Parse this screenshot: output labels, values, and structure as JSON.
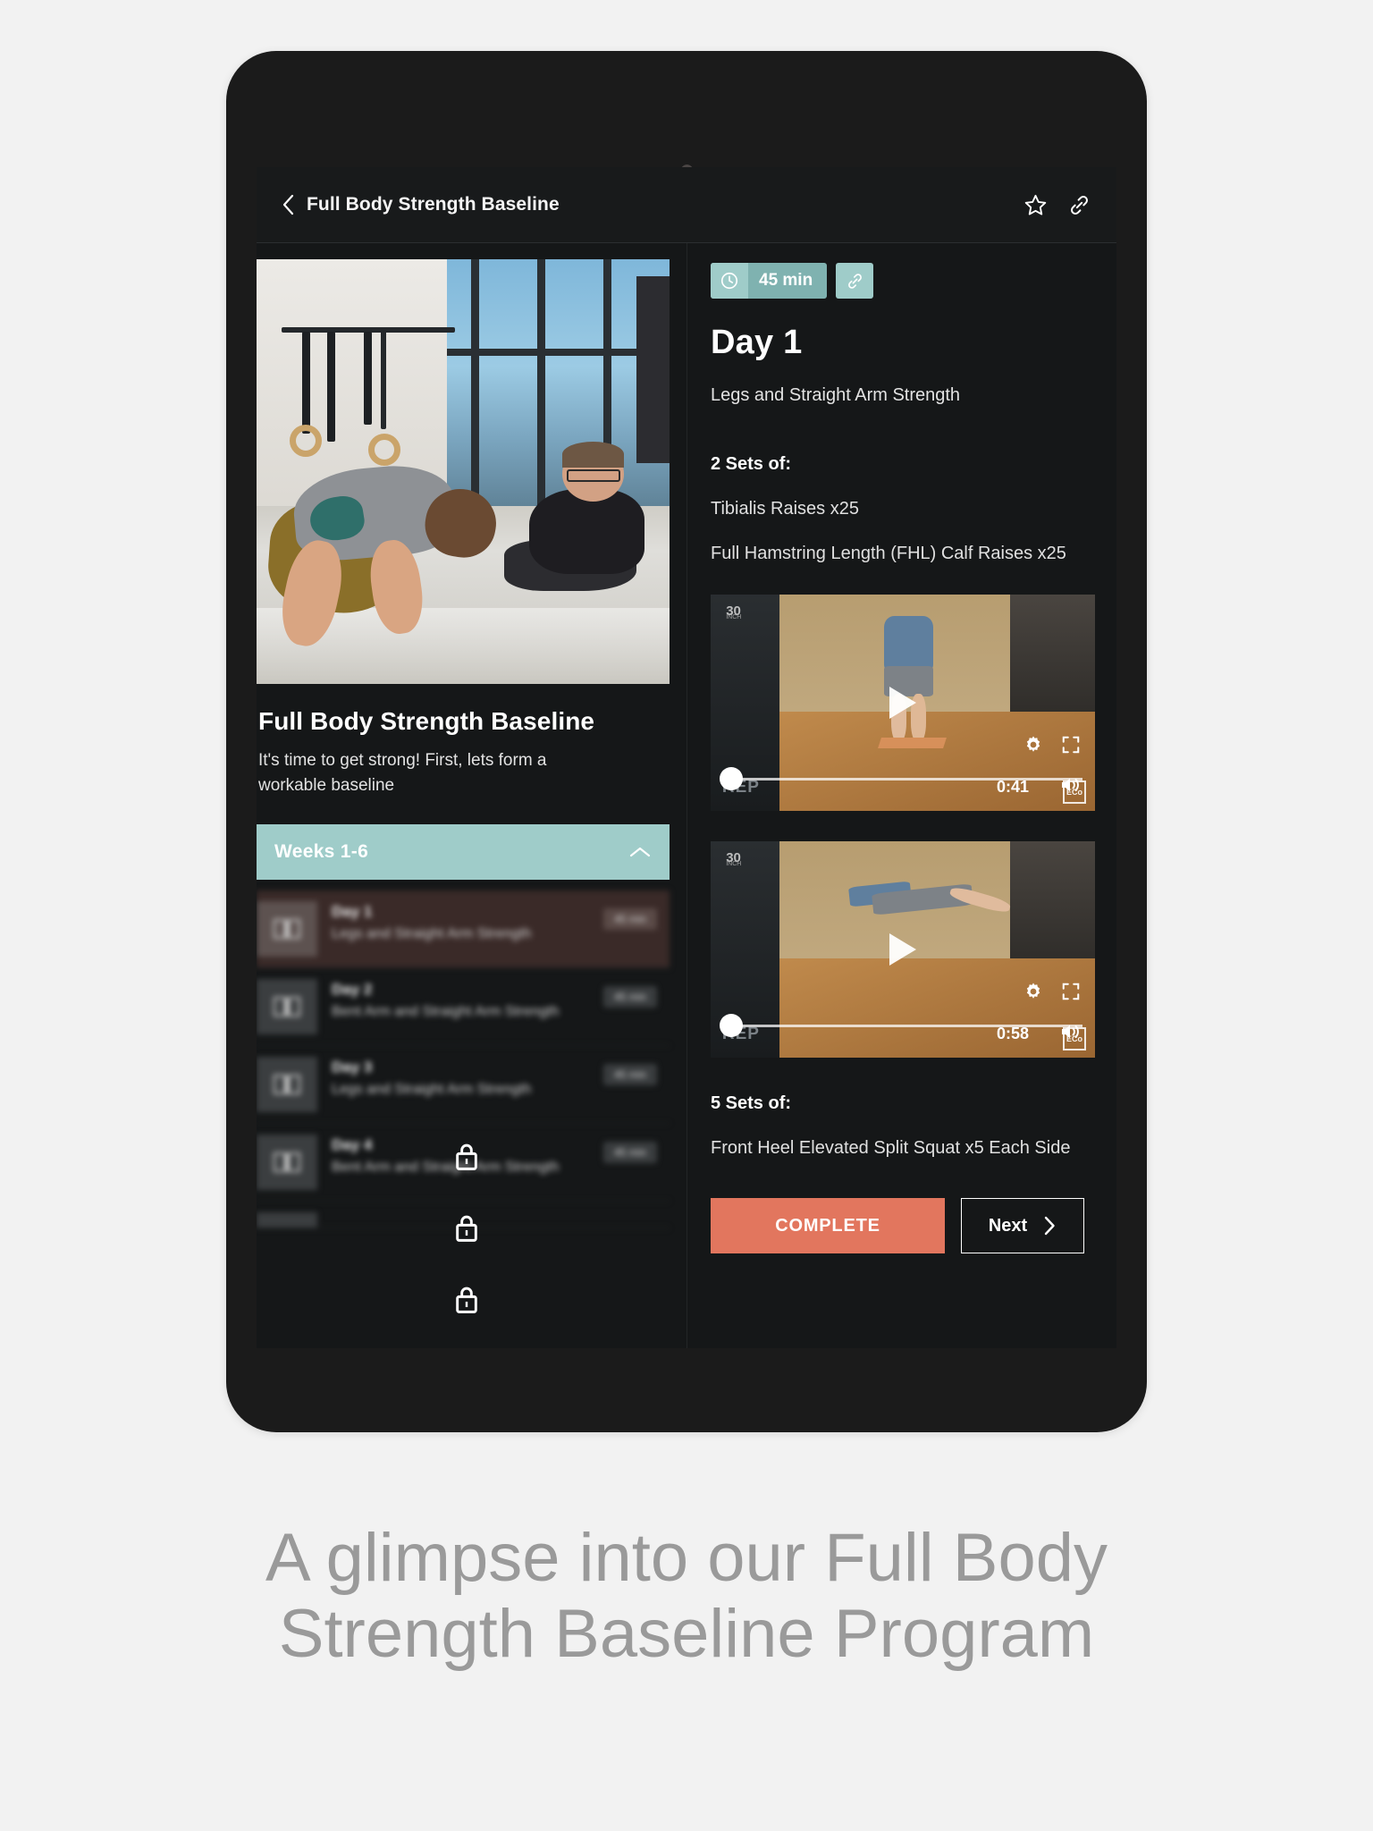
{
  "header": {
    "title": "Full Body Strength Baseline",
    "back_icon": "chevron-left-icon",
    "star_icon": "star-icon",
    "link_icon": "link-icon"
  },
  "left_panel": {
    "hero_photo_alt": "gym-training-photo",
    "program_title": "Full Body Strength Baseline",
    "program_description": "It's time to get strong! First, lets form a workable baseline",
    "accordion": {
      "label": "Weeks 1-6",
      "expanded": true,
      "chevron_icon": "chevron-up-icon"
    },
    "days": [
      {
        "name": "Day 1",
        "subtitle": "Legs and Straight Arm Strength",
        "badge": "45 min",
        "locked": true,
        "active": true
      },
      {
        "name": "Day 2",
        "subtitle": "Bent Arm and Straight Arm Strength",
        "badge": "45 min",
        "locked": true,
        "active": false
      },
      {
        "name": "Day 3",
        "subtitle": "Legs and Straight Arm Strength",
        "badge": "45 min",
        "locked": true,
        "active": false
      },
      {
        "name": "Day 4",
        "subtitle": "Bent Arm and Straight Arm Strength",
        "badge": "45 min",
        "locked": true,
        "active": false
      }
    ]
  },
  "right_panel": {
    "duration": "45 min",
    "clock_icon": "clock-icon",
    "link_icon": "link-icon",
    "day_heading": "Day 1",
    "day_subtitle": "Legs and Straight Arm Strength",
    "blocks": [
      {
        "sets_heading": "2 Sets of:",
        "exercises": [
          "Tibialis Raises x25",
          "Full Hamstring Length (FHL) Calf Raises x25"
        ]
      }
    ],
    "videos": [
      {
        "time": "0:41",
        "progress": 0,
        "play_icon": "play-icon",
        "gear_icon": "gear-icon",
        "fullscreen_icon": "fullscreen-icon",
        "volume_icon": "volume-icon",
        "watermark": "ECo"
      },
      {
        "time": "0:58",
        "progress": 0,
        "play_icon": "play-icon",
        "gear_icon": "gear-icon",
        "fullscreen_icon": "fullscreen-icon",
        "volume_icon": "volume-icon",
        "watermark": "ECo"
      }
    ],
    "second_block": {
      "sets_heading": "5 Sets of:",
      "exercise": "Front Heel Elevated Split Squat x5 Each Side"
    },
    "complete_label": "COMPLETE",
    "next_label": "Next",
    "next_icon": "chevron-right-icon"
  },
  "caption": {
    "line1": "A glimpse into our Full Body",
    "line2": "Strength Baseline Program"
  },
  "colors": {
    "accent_teal": "#9fccc9",
    "accent_coral": "#e2765e",
    "screen_bg": "#151718",
    "page_bg": "#f2f2f2",
    "caption_gray": "#9a9a9a"
  }
}
